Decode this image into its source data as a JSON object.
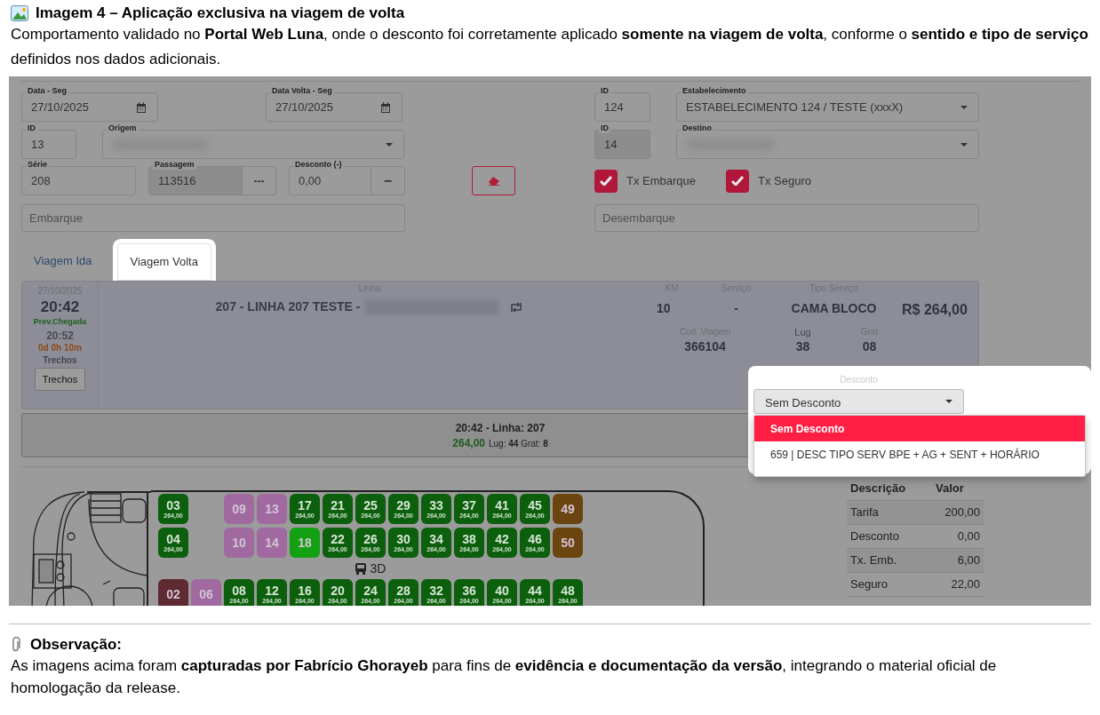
{
  "heading": {
    "title": "Imagem 4 – Aplicação exclusiva na viagem de volta",
    "text": "Comportamento validado no **Portal Web Luna**, onde o desconto foi corretamente aplicado **somente na viagem de volta**, conforme o **sentido e tipo de serviço** definidos nos dados adicionais."
  },
  "form": {
    "data": {
      "label": "Data - Seg",
      "value": "27/10/2025"
    },
    "data_volta": {
      "label": "Data Volta - Seg",
      "value": "27/10/2025"
    },
    "id_estabelecimento": {
      "label": "ID",
      "value": "124"
    },
    "estabelecimento": {
      "label": "Estabelecimento",
      "value": "ESTABELECIMENTO 124 / TESTE (xxxX)"
    },
    "id_origem": {
      "label": "ID",
      "value": "13"
    },
    "origem": {
      "label": "Origem"
    },
    "id_destino": {
      "label": "ID",
      "value": "14",
      "disabled": true
    },
    "destino": {
      "label": "Destino"
    },
    "serie": {
      "label": "Série",
      "value": "208"
    },
    "passagem": {
      "label": "Passagem",
      "value": "113516",
      "button": "---",
      "disabled": true
    },
    "desconto": {
      "label": "Desconto (-)",
      "value": "0,00",
      "button": "−"
    },
    "embarque": {
      "placeholder": "Embarque"
    },
    "desembarque": {
      "placeholder": "Desembarque"
    },
    "checkboxes": [
      {
        "label": "Tx Embarque",
        "checked": true
      },
      {
        "label": "Tx Seguro",
        "checked": true
      }
    ]
  },
  "tabs": [
    {
      "label": "Viagem Ida",
      "selected": false
    },
    {
      "label": "Viagem Volta",
      "selected": true
    }
  ],
  "trip": {
    "date": "27/10/2025",
    "departure": "20:42",
    "arrival_label": "Prev.Chegada",
    "arrival": "20:52",
    "duration": "0d 0h 10m",
    "trechos_label": "Trechos",
    "trechos_button": "Trechos",
    "linha_label": "Linha",
    "linha": "207 - LINHA 207 TESTE -",
    "km_label": "KM",
    "km": "10",
    "servico_label": "Serviço",
    "servico": "-",
    "tipo_label": "Tipo Serviço",
    "tipo": "CAMA BLOCO",
    "price": "R$ 264,00",
    "cod_label": "Cod. Viagem",
    "cod": "366104",
    "lug_label": "Lug",
    "lug": "38",
    "grat_label": "Grat",
    "grat": "08",
    "desconto_label": "Desconto",
    "desconto_value": "Sem Desconto",
    "options": [
      {
        "label": "Sem Desconto",
        "selected": true
      },
      {
        "label": "659 | DESC TIPO SERV BPE + AG + SENT + HORÁRIO",
        "selected": false
      }
    ]
  },
  "summary": {
    "title": "20:42 - Linha: 207",
    "price": "264,00",
    "details": "Lug: **44** Grat: **8**"
  },
  "seat_rows": [
    {
      "seats": [
        {
          "kind": "seat",
          "number": "03",
          "price": "264,00",
          "color": "#0c5f0c"
        },
        {
          "kind": "gap"
        },
        {
          "kind": "seat",
          "number": "09",
          "color": "#a06aa0"
        },
        {
          "kind": "seat",
          "number": "13",
          "color": "#a06aa0"
        },
        {
          "kind": "seat",
          "number": "17",
          "price": "264,00",
          "color": "#0c5f0c"
        },
        {
          "kind": "seat",
          "number": "21",
          "price": "264,00",
          "color": "#0c5f0c"
        },
        {
          "kind": "seat",
          "number": "25",
          "price": "264,00",
          "color": "#0c5f0c"
        },
        {
          "kind": "seat",
          "number": "29",
          "price": "264,00",
          "color": "#0c5f0c"
        },
        {
          "kind": "seat",
          "number": "33",
          "price": "264,00",
          "color": "#0c5f0c"
        },
        {
          "kind": "seat",
          "number": "37",
          "price": "264,00",
          "color": "#0c5f0c"
        },
        {
          "kind": "seat",
          "number": "41",
          "price": "264,00",
          "color": "#0c5f0c"
        },
        {
          "kind": "seat",
          "number": "45",
          "price": "264,00",
          "color": "#0c5f0c"
        },
        {
          "kind": "seat",
          "number": "49",
          "color": "#6b4510"
        }
      ]
    },
    {
      "seats": [
        {
          "kind": "seat",
          "number": "04",
          "price": "264,00",
          "color": "#0c5f0c"
        },
        {
          "kind": "gap"
        },
        {
          "kind": "seat",
          "number": "10",
          "color": "#a06aa0"
        },
        {
          "kind": "seat",
          "number": "14",
          "color": "#a06aa0"
        },
        {
          "kind": "seat",
          "number": "18",
          "color": "#13a013"
        },
        {
          "kind": "seat",
          "number": "22",
          "price": "264,00",
          "color": "#0c5f0c"
        },
        {
          "kind": "seat",
          "number": "26",
          "price": "264,00",
          "color": "#0c5f0c"
        },
        {
          "kind": "seat",
          "number": "30",
          "price": "264,00",
          "color": "#0c5f0c"
        },
        {
          "kind": "seat",
          "number": "34",
          "price": "264,00",
          "color": "#0c5f0c"
        },
        {
          "kind": "seat",
          "number": "38",
          "price": "264,00",
          "color": "#0c5f0c"
        },
        {
          "kind": "seat",
          "number": "42",
          "price": "264,00",
          "color": "#0c5f0c"
        },
        {
          "kind": "seat",
          "number": "46",
          "price": "264,00",
          "color": "#0c5f0c"
        },
        {
          "kind": "seat",
          "number": "50",
          "color": "#6b4510"
        }
      ]
    },
    {
      "seats": [
        {
          "kind": "seat",
          "number": "02",
          "color": "#5f2b33"
        },
        {
          "kind": "seat",
          "number": "06",
          "color": "#a06aa0"
        },
        {
          "kind": "seat",
          "number": "08",
          "price": "264,00",
          "color": "#0c5f0c"
        },
        {
          "kind": "seat",
          "number": "12",
          "price": "264,00",
          "color": "#0c5f0c"
        },
        {
          "kind": "seat",
          "number": "16",
          "price": "264,00",
          "color": "#0c5f0c"
        },
        {
          "kind": "seat",
          "number": "20",
          "price": "264,00",
          "color": "#0c5f0c"
        },
        {
          "kind": "seat",
          "number": "24",
          "price": "264,00",
          "color": "#0c5f0c"
        },
        {
          "kind": "seat",
          "number": "28",
          "price": "264,00",
          "color": "#0c5f0c"
        },
        {
          "kind": "seat",
          "number": "32",
          "price": "264,00",
          "color": "#0c5f0c"
        },
        {
          "kind": "seat",
          "number": "36",
          "price": "264,00",
          "color": "#0c5f0c"
        },
        {
          "kind": "seat",
          "number": "40",
          "price": "264,00",
          "color": "#0c5f0c"
        },
        {
          "kind": "seat",
          "number": "44",
          "price": "264,00",
          "color": "#0c5f0c"
        },
        {
          "kind": "seat",
          "number": "48",
          "price": "264,00",
          "color": "#0c5f0c"
        }
      ]
    }
  ],
  "aisle_label": "3D",
  "fare_table": {
    "columns": [
      "Descrição",
      "Valor"
    ],
    "rows": [
      [
        "Tarifa",
        "200,00"
      ],
      [
        "Desconto",
        "0,00"
      ],
      [
        "Tx. Emb.",
        "6,00"
      ],
      [
        "Seguro",
        "22,00"
      ]
    ]
  },
  "note": {
    "title": "Observação:",
    "text": "As imagens acima foram **capturadas por Fabrício Ghorayeb** para fins de **evidência e documentação da versão**, integrando o material oficial de homologação da release."
  }
}
